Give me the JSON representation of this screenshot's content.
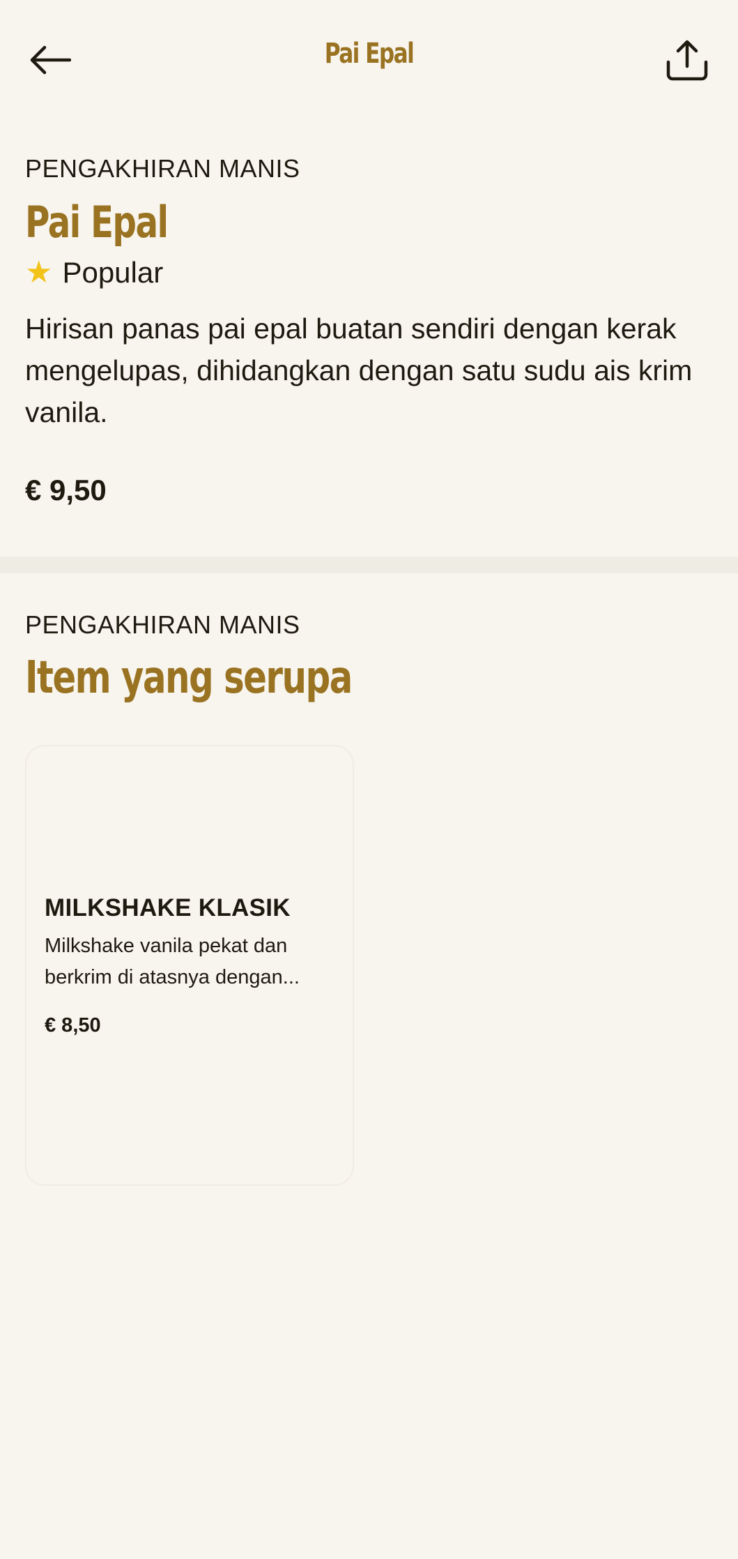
{
  "header": {
    "title": "Pai Epal",
    "back_icon": "arrow-left-icon",
    "share_icon": "share-icon"
  },
  "item": {
    "category": "PENGAKHIRAN MANIS",
    "name": "Pai Epal",
    "badge": "Popular",
    "badge_icon": "star-icon",
    "description": "Hirisan panas pai epal buatan sendiri dengan kerak mengelupas, dihidangkan dengan satu sudu ais krim vanila.",
    "price": "€ 9,50"
  },
  "similar": {
    "category": "PENGAKHIRAN MANIS",
    "title": "Item yang serupa",
    "cards": [
      {
        "name": "MILKSHAKE KLASIK",
        "description": "Milkshake vanila pekat dan berkrim di atasnya dengan...",
        "price": "€ 8,50"
      }
    ]
  },
  "colors": {
    "background": "#F8F5EF",
    "accent": "#9A7322",
    "text": "#1F1A10",
    "star": "#F2C31B",
    "divider": "#EFECE4"
  }
}
